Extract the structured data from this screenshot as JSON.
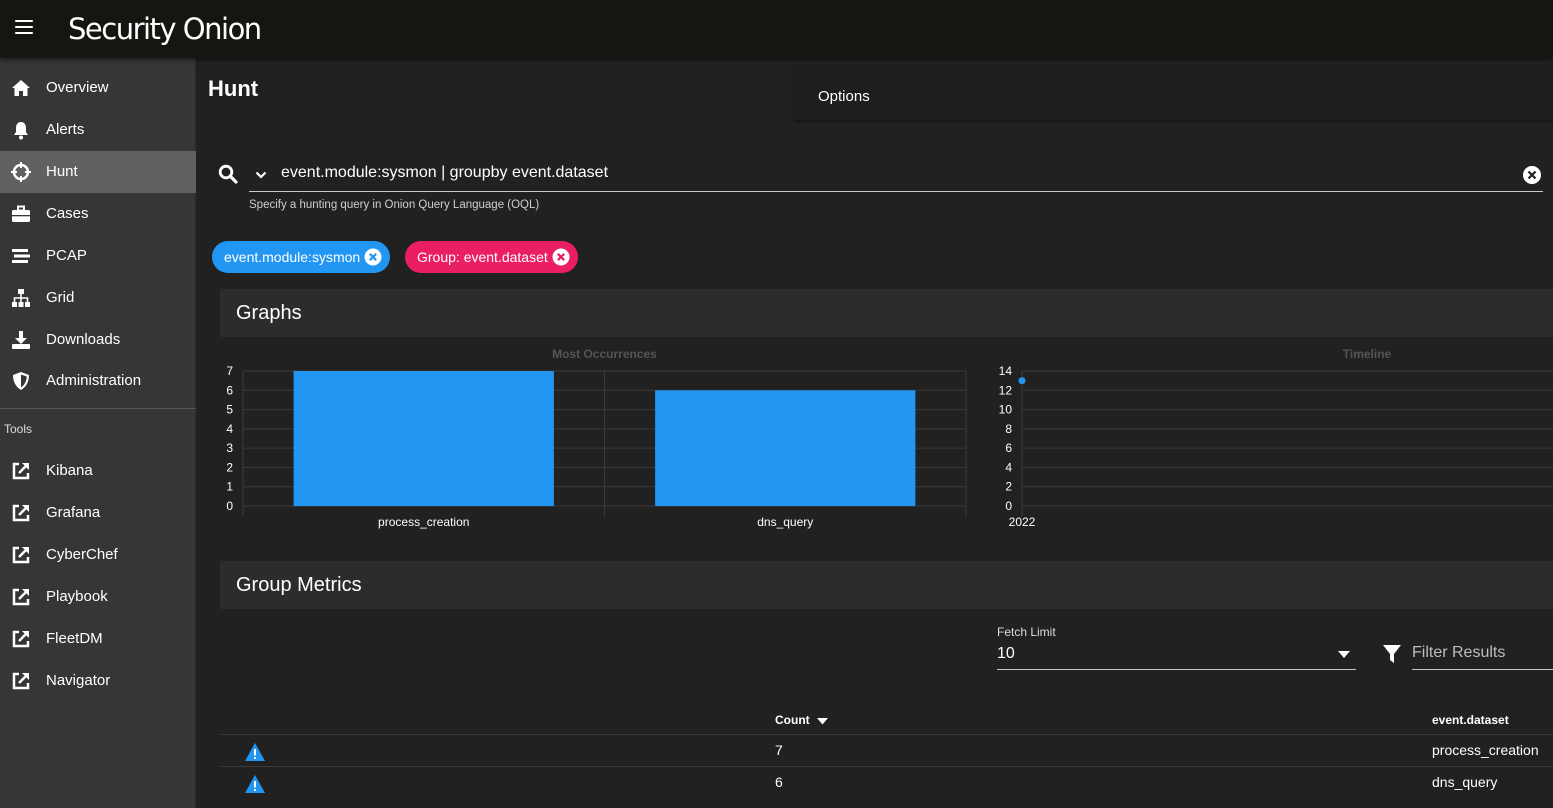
{
  "header": {
    "logo_text": "Security Onion"
  },
  "sidebar": {
    "items": [
      {
        "label": "Overview",
        "icon": "home-icon"
      },
      {
        "label": "Alerts",
        "icon": "bell-icon"
      },
      {
        "label": "Hunt",
        "icon": "crosshairs-icon",
        "active": true
      },
      {
        "label": "Cases",
        "icon": "briefcase-icon"
      },
      {
        "label": "PCAP",
        "icon": "stream-icon"
      },
      {
        "label": "Grid",
        "icon": "sitemap-icon"
      },
      {
        "label": "Downloads",
        "icon": "download-icon"
      },
      {
        "label": "Administration",
        "icon": "shield-icon"
      }
    ],
    "tools_header": "Tools",
    "tools": [
      {
        "label": "Kibana",
        "icon": "external-link-icon"
      },
      {
        "label": "Grafana",
        "icon": "external-link-icon"
      },
      {
        "label": "CyberChef",
        "icon": "external-link-icon"
      },
      {
        "label": "Playbook",
        "icon": "external-link-icon"
      },
      {
        "label": "FleetDM",
        "icon": "external-link-icon"
      },
      {
        "label": "Navigator",
        "icon": "external-link-icon"
      }
    ]
  },
  "page": {
    "title": "Hunt",
    "options_label": "Options"
  },
  "search": {
    "query": "event.module:sysmon | groupby event.dataset",
    "hint": "Specify a hunting query in Onion Query Language (OQL)"
  },
  "chips": [
    {
      "label": "event.module:sysmon",
      "color": "#2196f3"
    },
    {
      "label": "Group: event.dataset",
      "color": "#e91e63"
    }
  ],
  "graphs": {
    "title": "Graphs"
  },
  "chart_data": [
    {
      "type": "bar",
      "title": "Most Occurrences",
      "categories": [
        "process_creation",
        "dns_query"
      ],
      "values": [
        7,
        6
      ],
      "ylim": [
        0,
        7
      ],
      "yticks": [
        "0",
        "1",
        "2",
        "3",
        "4",
        "5",
        "6",
        "7"
      ],
      "color": "#2196f3"
    },
    {
      "type": "scatter",
      "title": "Timeline",
      "x": [
        "2022"
      ],
      "y": [
        13
      ],
      "ylim": [
        0,
        14
      ],
      "yticks": [
        "0",
        "2",
        "4",
        "6",
        "8",
        "10",
        "12",
        "14"
      ],
      "xtick": "2022",
      "color": "#2196f3"
    }
  ],
  "metrics": {
    "title": "Group Metrics",
    "fetch_limit_label": "Fetch Limit",
    "fetch_limit_value": "10",
    "filter_placeholder": "Filter Results",
    "columns": [
      "Count",
      "event.dataset"
    ],
    "rows": [
      {
        "count": "7",
        "dataset": "process_creation"
      },
      {
        "count": "6",
        "dataset": "dns_query"
      }
    ]
  },
  "colors": {
    "accent": "#2196f3",
    "chip_pink": "#e91e63",
    "warning": "#2196f3"
  }
}
